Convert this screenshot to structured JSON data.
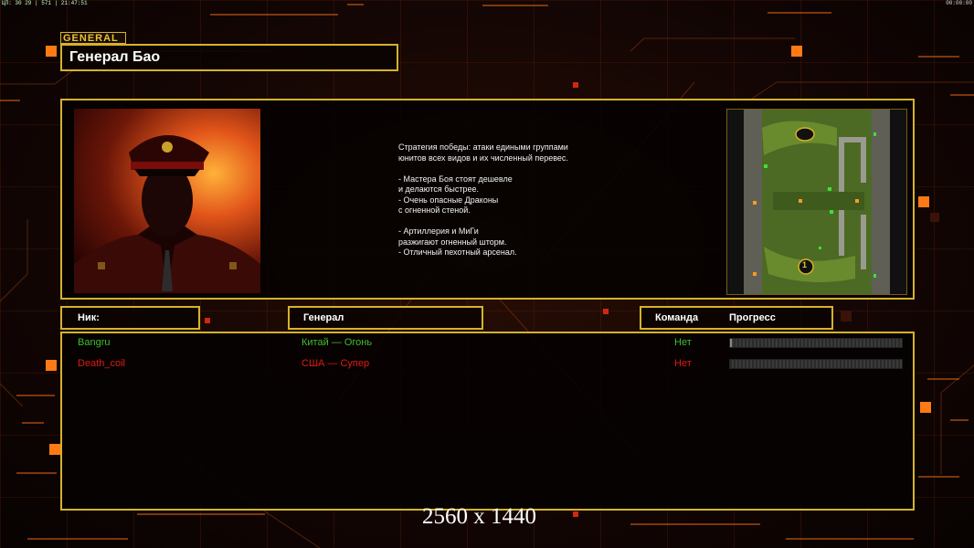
{
  "topbar": {
    "stats": "ЦП: 30 29 | 571 | 21:47:51",
    "clock": "00:00:00"
  },
  "general_label": "GENERAL",
  "general_name": "Генерал Бао",
  "description": "Стратегия победы: атаки едиными группами\nюнитов всех видов и их численный перевес.\n\n- Мастера Боя стоят дешевле\nи делаются быстрее.\n- Очень опасные Драконы\nс огненной стеной.\n\n- Артиллерия и МиГи\nразжигают огненный шторм.\n- Отличный пехотный арсенал.",
  "headers": {
    "nick": "Ник:",
    "general": "Генерал",
    "team": "Команда",
    "progress": "Прогресс"
  },
  "players": [
    {
      "nick": "Bangru",
      "general": "Китай — Огонь",
      "team": "Нет",
      "color": "#3fbf2c",
      "progress": 0.01
    },
    {
      "nick": "Death_coil",
      "general": "США — Супер",
      "team": "Нет",
      "color": "#e01a14",
      "progress": 0
    }
  ],
  "resolution": "2560 x 1440",
  "colors": {
    "accent": "#d6b22a",
    "orange": "#ff8a1a"
  },
  "minimap_markers": [
    "1"
  ]
}
